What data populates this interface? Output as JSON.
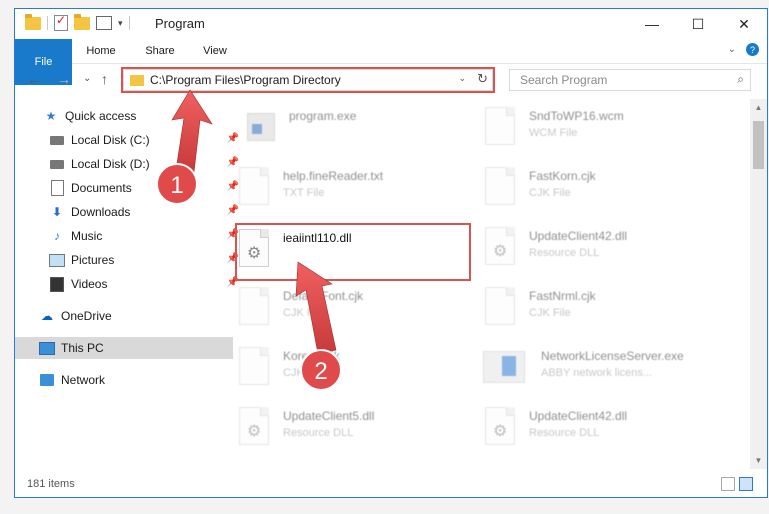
{
  "window": {
    "title": "Program",
    "controls": {
      "minimize": "—",
      "maximize": "☐",
      "close": "✕"
    }
  },
  "ribbon": {
    "tabs": [
      {
        "label": "File"
      },
      {
        "label": "Home"
      },
      {
        "label": "Share"
      },
      {
        "label": "View"
      }
    ],
    "expand_glyph": "⌄",
    "help_glyph": "?"
  },
  "nav": {
    "back": "←",
    "forward": "→",
    "recent": "⌄",
    "up": "↑",
    "address_path": "C:\\Program Files\\Program Directory",
    "address_dropdown": "⌄",
    "refresh": "↻",
    "search_placeholder": "Search Program",
    "search_glyph": "⌕"
  },
  "sidebar": {
    "items": [
      {
        "label": "Quick access",
        "icon": "star-icon",
        "pinned": false
      },
      {
        "label": "Local Disk (C:)",
        "icon": "drive-icon",
        "pinned": true
      },
      {
        "label": "Local Disk (D:)",
        "icon": "drive-icon",
        "pinned": true
      },
      {
        "label": "Documents",
        "icon": "document-icon",
        "pinned": true
      },
      {
        "label": "Downloads",
        "icon": "download-icon",
        "pinned": true
      },
      {
        "label": "Music",
        "icon": "music-icon",
        "pinned": true
      },
      {
        "label": "Pictures",
        "icon": "pictures-icon",
        "pinned": true
      },
      {
        "label": "Videos",
        "icon": "video-icon",
        "pinned": true
      },
      {
        "label": "OneDrive",
        "icon": "cloud-icon",
        "pinned": false
      },
      {
        "label": "This PC",
        "icon": "computer-icon",
        "pinned": false,
        "selected": true
      },
      {
        "label": "Network",
        "icon": "network-icon",
        "pinned": false
      }
    ],
    "pin_glyph": "📌"
  },
  "files": [
    {
      "name": "program.exe",
      "type": "",
      "icon": "exe-icon"
    },
    {
      "name": "SndToWP16.wcm",
      "type": "WCM File",
      "icon": "file-icon"
    },
    {
      "name": "help.fineReader.txt",
      "type": "TXT File",
      "icon": "file-icon"
    },
    {
      "name": "FastKorn.cjk",
      "type": "CJK File",
      "icon": "file-icon"
    },
    {
      "name": "ieaiintl110.dll",
      "type": "",
      "icon": "dll-icon",
      "highlighted": true
    },
    {
      "name": "UpdateClient42.dll",
      "type": "Resource DLL",
      "icon": "dll-icon"
    },
    {
      "name": "DefaultFont.cjk",
      "type": "CJK File",
      "icon": "file-icon"
    },
    {
      "name": "FastNrml.cjk",
      "type": "CJK File",
      "icon": "file-icon"
    },
    {
      "name": "Korean.cjk",
      "type": "CJK File",
      "icon": "file-icon"
    },
    {
      "name": "NetworkLicenseServer.exe",
      "type": "ABBY network licens...",
      "icon": "app-icon"
    },
    {
      "name": "UpdateClient5.dll",
      "type": "Resource DLL",
      "icon": "dll-icon"
    },
    {
      "name": "UpdateClient42.dll",
      "type": "Resource DLL",
      "icon": "dll-icon"
    }
  ],
  "callouts": [
    {
      "number": "1"
    },
    {
      "number": "2"
    }
  ],
  "status": {
    "item_count": "181 items"
  },
  "colors": {
    "accent": "#1979ca",
    "highlight": "#d9534f",
    "callout": "#e04a4a"
  }
}
